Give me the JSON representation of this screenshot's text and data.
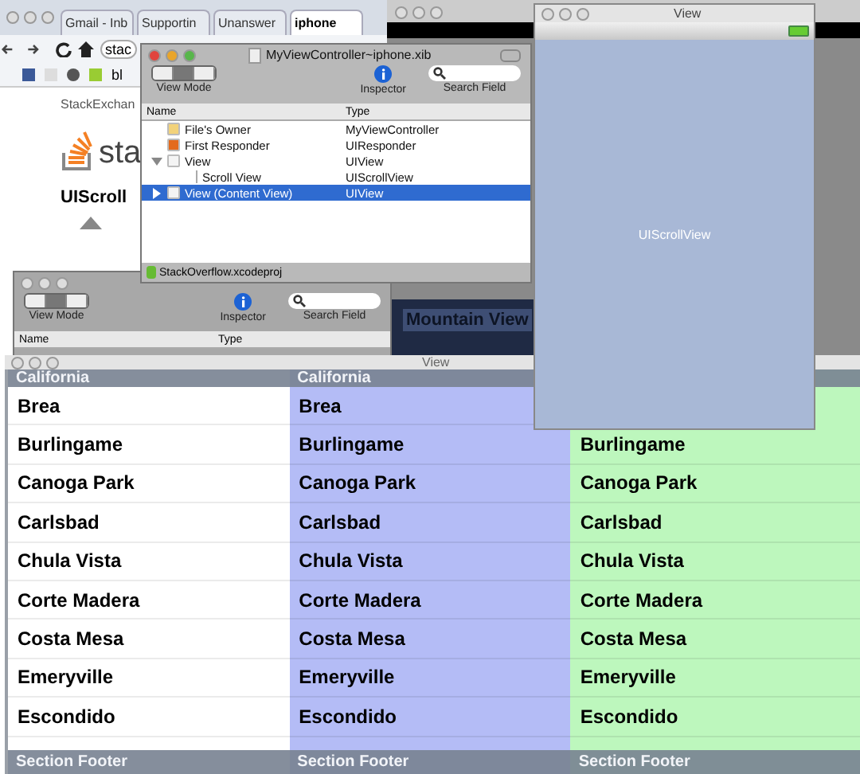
{
  "browser": {
    "tabs": [
      {
        "label": "Gmail - Inb",
        "selected": false
      },
      {
        "label": "Supportin",
        "selected": false
      },
      {
        "label": "Unanswer",
        "selected": false
      },
      {
        "label": "iphone",
        "selected": true
      }
    ],
    "address": "stac",
    "bookmark": "bl",
    "site_header": "StackExchan",
    "logo_text": "sta",
    "heading": "UIScroll"
  },
  "xib_window": {
    "title": "MyViewController~iphone.xib",
    "toolbar": [
      "View Mode",
      "Inspector",
      "Search Field"
    ],
    "columns": [
      "Name",
      "Type"
    ],
    "rows": [
      {
        "name": "File's Owner",
        "type": "MyViewController",
        "kind": "owner",
        "selected": false
      },
      {
        "name": "First Responder",
        "type": "UIResponder",
        "kind": "responder",
        "selected": false
      },
      {
        "name": "View",
        "type": "UIView",
        "kind": "view",
        "selected": false,
        "expanded": true,
        "children": [
          {
            "name": "Scroll View",
            "type": "UIScrollView",
            "kind": "scroll",
            "selected": false
          }
        ]
      },
      {
        "name": "View (Content View)",
        "type": "UIView",
        "kind": "view",
        "selected": true,
        "expanded": false
      }
    ],
    "status": "StackOverflow.xcodeproj"
  },
  "xib_window_back": {
    "toolbar": [
      "View Mode",
      "Inspector",
      "Search Field"
    ],
    "columns": [
      "Name",
      "Type"
    ]
  },
  "map_window": {
    "title": "Mountain View"
  },
  "view_window": {
    "title": "View",
    "content_label": "UIScrollView"
  },
  "table_window": {
    "title": "View",
    "columns": [
      {
        "color": "#ffffff",
        "header": "California",
        "rows": [
          "Brea",
          "Burlingame",
          "Canoga Park",
          "Carlsbad",
          "Chula Vista",
          "Corte Madera",
          "Costa Mesa",
          "Emeryville",
          "Escondido"
        ],
        "footer": "Section Footer"
      },
      {
        "color": "#b4bcf6",
        "header": "California",
        "rows": [
          "Brea",
          "Burlingame",
          "Canoga Park",
          "Carlsbad",
          "Chula Vista",
          "Corte Madera",
          "Costa Mesa",
          "Emeryville",
          "Escondido"
        ],
        "footer": "Section Footer"
      },
      {
        "color": "#bdf7bd",
        "rows": [
          "Burlingame",
          "Canoga Park",
          "Carlsbad",
          "Chula Vista",
          "Corte Madera",
          "Costa Mesa",
          "Emeryville",
          "Escondido"
        ],
        "footer": "Section Footer"
      }
    ]
  }
}
